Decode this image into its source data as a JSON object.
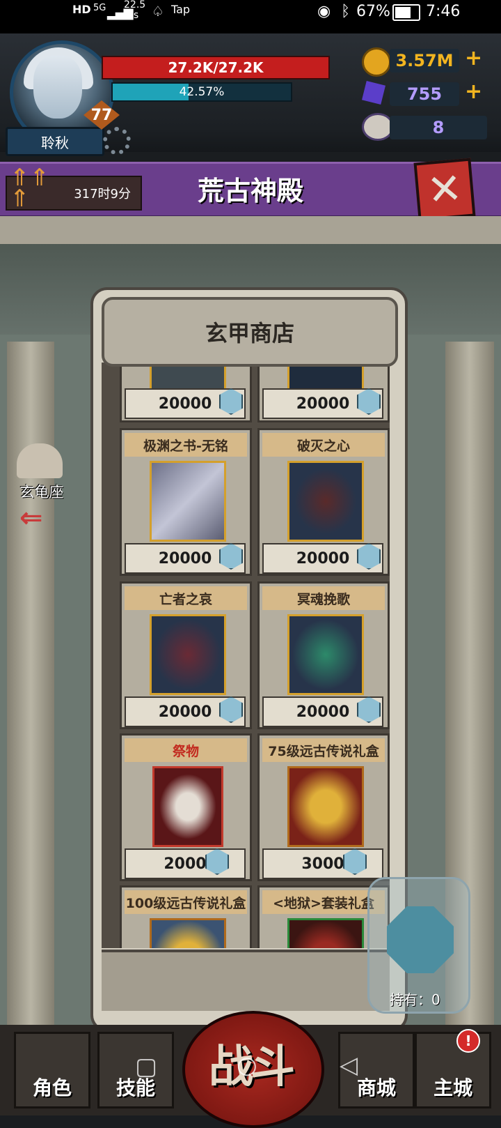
{
  "status_bar": {
    "left_items": [
      "HD",
      "5G",
      "22.5 K/s",
      "Tap"
    ],
    "battery": "67%",
    "time": "7:46"
  },
  "player": {
    "name": "聆秋",
    "level": "77",
    "hp": "27.2K/27.2K",
    "xp": "42.57%",
    "xp_fraction": 0.4257
  },
  "resources": {
    "gold": "3.57M",
    "crystal": "755",
    "skull": "8"
  },
  "header": {
    "title": "荒古神殿",
    "timer": "317时9分"
  },
  "side_nav": {
    "label": "玄龟座"
  },
  "shop": {
    "title": "玄甲商店",
    "items": [
      {
        "name": "",
        "price": "20000",
        "icon": "stone-armor-icon"
      },
      {
        "name": "",
        "price": "20000",
        "icon": "dark-weapon-icon"
      },
      {
        "name": "极渊之书-无铭",
        "price": "20000",
        "icon": "scroll-icon"
      },
      {
        "name": "破灭之心",
        "price": "20000",
        "icon": "thorn-heart-icon"
      },
      {
        "name": "亡者之哀",
        "price": "20000",
        "icon": "bone-scythe-icon"
      },
      {
        "name": "冥魂挽歌",
        "price": "20000",
        "icon": "jade-scythe-icon"
      },
      {
        "name": "祭物",
        "price": "2000",
        "icon": "ram-skull-icon"
      },
      {
        "name": "75级远古传说礼盒",
        "price": "3000",
        "icon": "treasure-chest-icon"
      },
      {
        "name": "100级远古传说礼盒",
        "price": "",
        "icon": "dragon-chest-icon"
      },
      {
        "name": "<地狱>套装礼盒",
        "price": "",
        "icon": "hell-set-icon"
      }
    ],
    "held_label": "持有：0"
  },
  "bottom_nav": {
    "character": "角色",
    "skills": "技能",
    "battle": "战斗",
    "shop": "商城",
    "city": "主城",
    "city_badge": "!"
  },
  "colors": {
    "hp_bar": "#c41e1e",
    "xp_bar": "#1fa3b8",
    "title_bar": "#6a3e8c",
    "gold_text": "#f2b520",
    "crystal_text": "#b39cff"
  }
}
